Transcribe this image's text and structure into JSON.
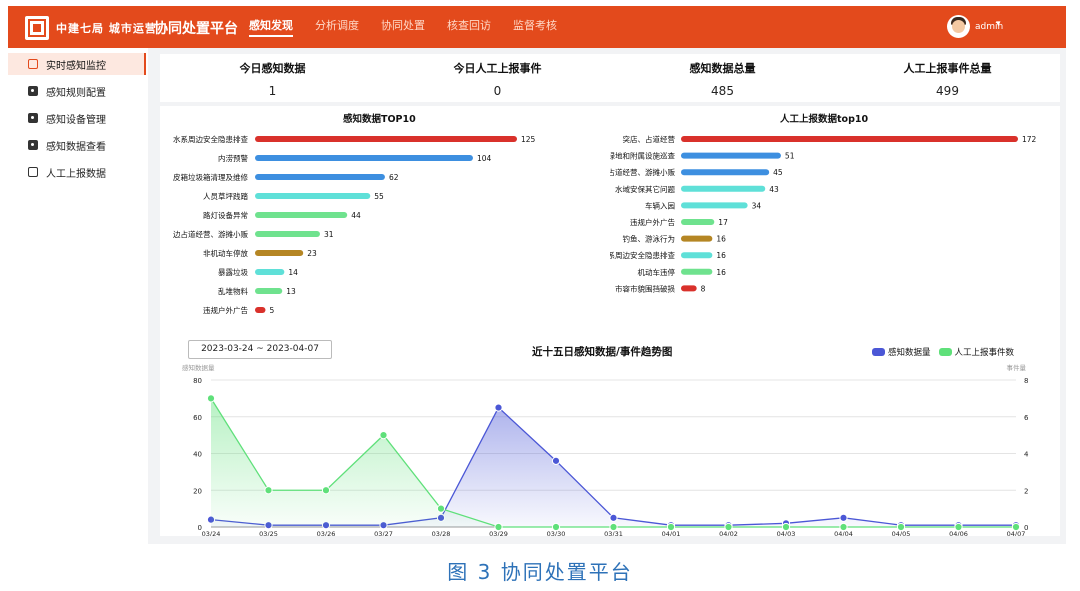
{
  "header": {
    "org_name": "中建七局  城市运营",
    "title": "协同处置平台",
    "nav": [
      {
        "label": "感知发现",
        "active": true
      },
      {
        "label": "分析调度",
        "active": false
      },
      {
        "label": "协同处置",
        "active": false
      },
      {
        "label": "核查回访",
        "active": false
      },
      {
        "label": "监督考核",
        "active": false
      }
    ],
    "user": "admin",
    "caret_icon": "caret-down-icon"
  },
  "sidebar": {
    "items": [
      {
        "label": "实时感知监控",
        "icon": "monitor-icon",
        "active": true
      },
      {
        "label": "感知规则配置",
        "icon": "rule-icon",
        "active": false
      },
      {
        "label": "感知设备管理",
        "icon": "device-icon",
        "active": false
      },
      {
        "label": "感知数据查看",
        "icon": "data-view-icon",
        "active": false
      },
      {
        "label": "人工上报数据",
        "icon": "report-icon",
        "active": false
      }
    ]
  },
  "stats": [
    {
      "label": "今日感知数据",
      "value": "1"
    },
    {
      "label": "今日人工上报事件",
      "value": "0"
    },
    {
      "label": "感知数据总量",
      "value": "485"
    },
    {
      "label": "人工上报事件总量",
      "value": "499"
    }
  ],
  "caption": "图 3   协同处置平台",
  "colors": {
    "header": "#e34a1c",
    "red": "#d9312b",
    "blue": "#3d8fe0",
    "cyan": "#5fe0d8",
    "green": "#6fe28e",
    "brown": "#b58624",
    "series_perception": "#4b57d6",
    "series_manual": "#5fe07a"
  },
  "chart_data": [
    {
      "type": "bar",
      "orientation": "horizontal",
      "title": "感知数据TOP10",
      "categories": [
        "水系周边安全隐患排查",
        "内涝预警",
        "皮箱垃圾箱清理及维修",
        "人员草坪践踏",
        "路灯设备异常",
        "边占道经营、游摊小贩",
        "非机动车停放",
        "暴露垃圾",
        "乱堆物料",
        "违规户外广告"
      ],
      "values": [
        125,
        104,
        62,
        55,
        44,
        31,
        23,
        14,
        13,
        5
      ],
      "bar_colors": [
        "red",
        "blue",
        "blue",
        "cyan",
        "green",
        "green",
        "brown",
        "cyan",
        "green",
        "red"
      ],
      "max": 125
    },
    {
      "type": "bar",
      "orientation": "horizontal",
      "title": "人工上报数据top10",
      "categories": [
        "突店、占道经营",
        "属绿地和附属设施巡查",
        "边占道经营、游摊小贩",
        "水域安保其它问题",
        "车辆入园",
        "违规户外广告",
        "钓鱼、游泳行为",
        "水系周边安全隐患排查",
        "机动车违停",
        "市容市貌围挡破损"
      ],
      "values": [
        172,
        51,
        45,
        43,
        34,
        17,
        16,
        16,
        16,
        8
      ],
      "bar_colors": [
        "red",
        "blue",
        "blue",
        "cyan",
        "cyan",
        "green",
        "brown",
        "cyan",
        "green",
        "red"
      ],
      "max": 172
    },
    {
      "type": "area",
      "title": "近十五日感知数据/事件趋势图",
      "date_range": "2023-03-24   ~   2023-04-07",
      "x": [
        "03/24",
        "03/25",
        "03/26",
        "03/27",
        "03/28",
        "03/29",
        "03/30",
        "03/31",
        "04/01",
        "04/02",
        "04/03",
        "04/04",
        "04/05",
        "04/06",
        "04/07"
      ],
      "ylabel_left": "感知数据量",
      "ylabel_right": "事件量",
      "ylim_left": [
        0,
        80
      ],
      "yticks_left": [
        0,
        20,
        40,
        60,
        80
      ],
      "ylim_right": [
        0,
        8
      ],
      "yticks_right": [
        0,
        2,
        4,
        6,
        8
      ],
      "grid": true,
      "legend_position": "top-right",
      "series": [
        {
          "name": "感知数据量",
          "axis": "left",
          "color": "series_perception",
          "values": [
            4,
            1,
            1,
            1,
            5,
            65,
            36,
            5,
            1,
            1,
            2,
            5,
            1,
            1,
            1
          ]
        },
        {
          "name": "人工上报事件数",
          "axis": "right",
          "color": "series_manual",
          "values": [
            7,
            2,
            2,
            5,
            1,
            0,
            0,
            0,
            0,
            0,
            0,
            0,
            0,
            0,
            0
          ]
        }
      ]
    }
  ]
}
